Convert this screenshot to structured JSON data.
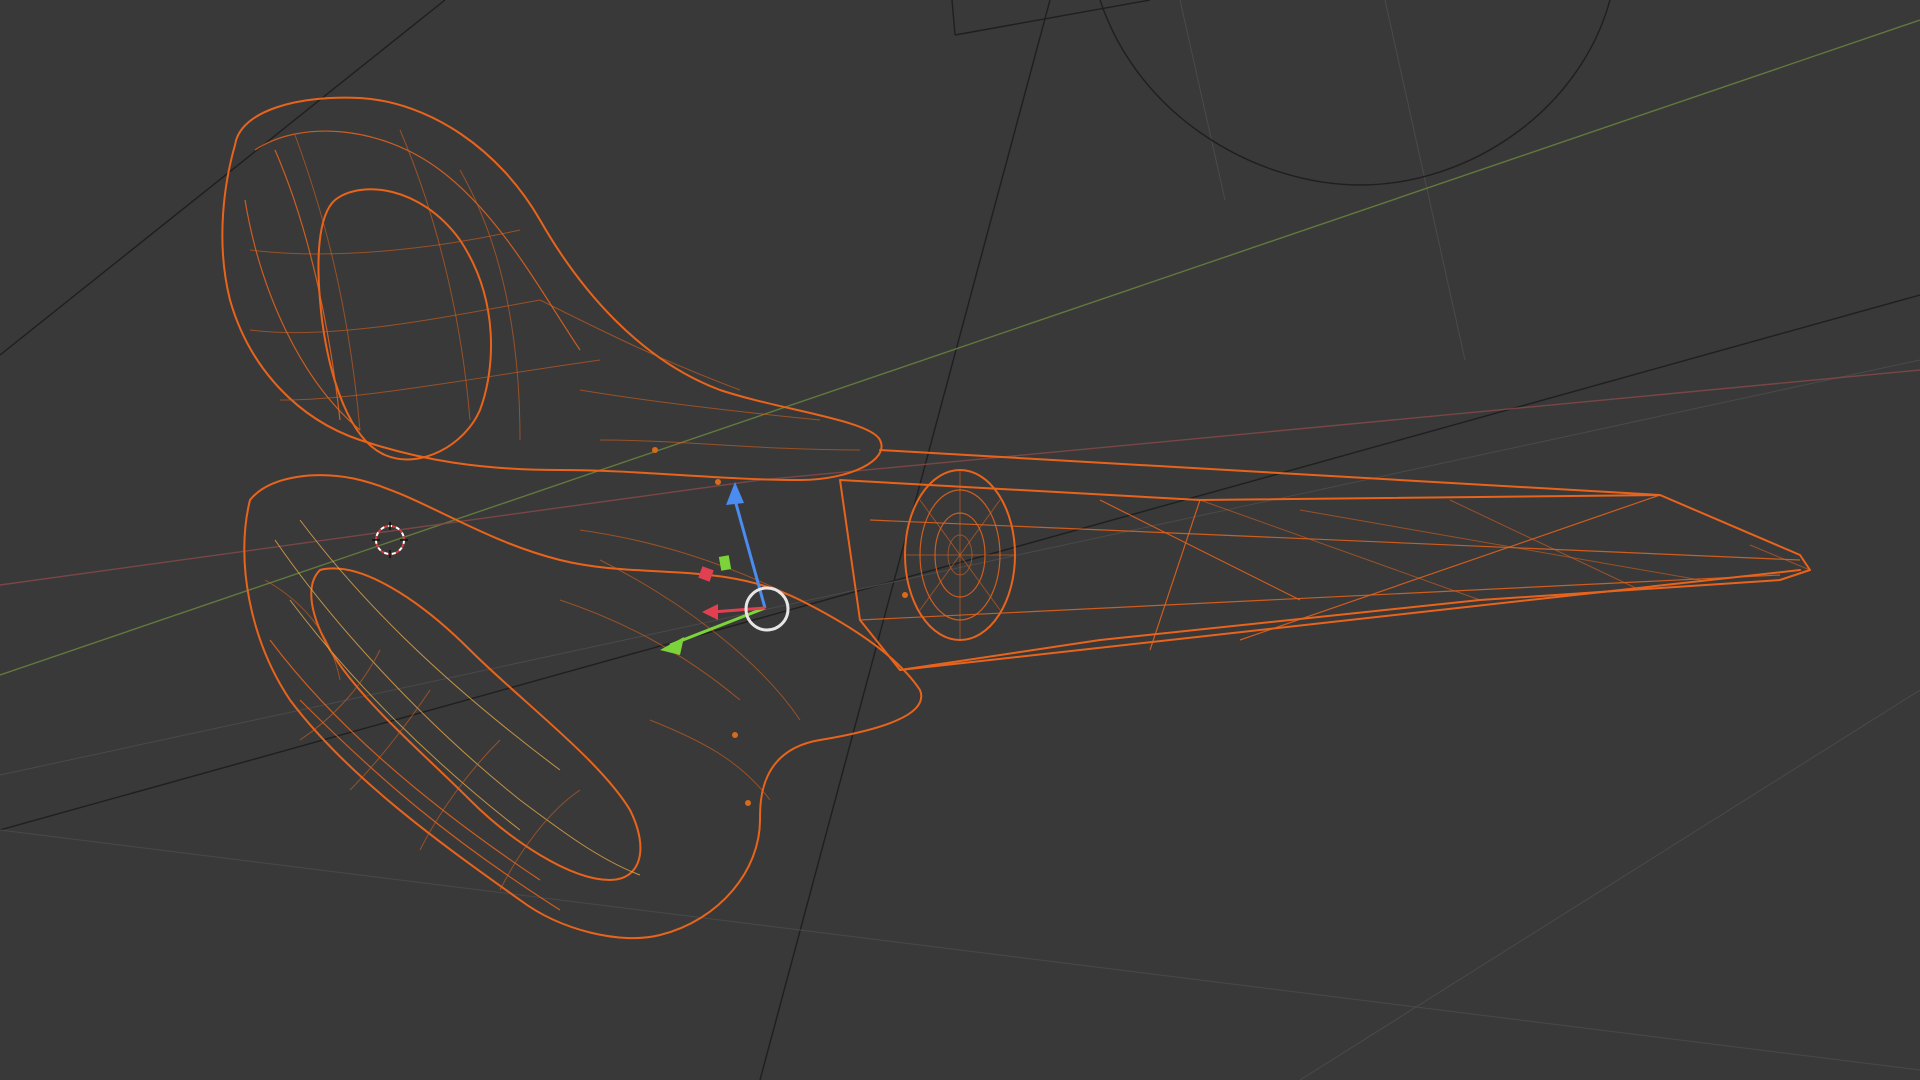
{
  "viewport": {
    "mode": "wireframe",
    "object": "scissors",
    "colors": {
      "background": "#393939",
      "selected_wire": "#e8641c",
      "wire_highlight": "#f2b14a",
      "grid_line": "#1f1f1f",
      "axis_x": "#8a4a4a",
      "axis_y": "#6b8a3e",
      "gizmo_z": "#4a8cf0",
      "gizmo_y": "#7cd43a",
      "gizmo_x": "#e04050",
      "pivot_ring": "#e6e6e6"
    },
    "icons": {
      "transform_gizmo": "move-gizmo-icon",
      "cursor_3d": "3d-cursor-icon",
      "origin": "object-origin-icon"
    }
  }
}
